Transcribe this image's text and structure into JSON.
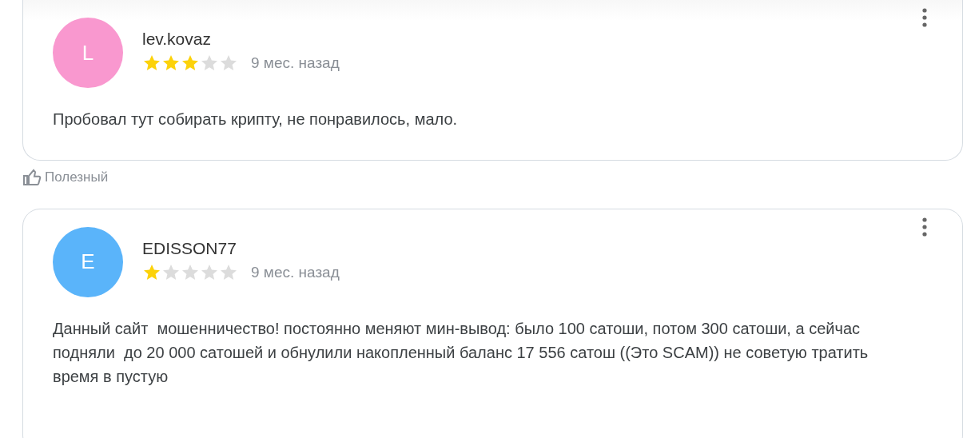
{
  "reviews": [
    {
      "avatar_letter": "L",
      "color": "#f998cf",
      "author": "lev.kovaz",
      "stars": 3,
      "time": "9 мес. назад",
      "text": "Пробовал тут собирать крипту, не понравилось, мало.",
      "helpful": "Полезный"
    },
    {
      "avatar_letter": "E",
      "color": "#5ab4fa",
      "author": "EDISSON77",
      "stars": 1,
      "time": "9 мес. назад",
      "text": "Данный сайт  мошенничество! постоянно меняют мин-вывод: было 100 сатоши, потом 300 сатоши, а сейчас подняли  до 20 000 сатошей и обнулили накопленный баланс 17 556 сатош ((Это SCAM)) не советую тратить время в пустую"
    }
  ]
}
